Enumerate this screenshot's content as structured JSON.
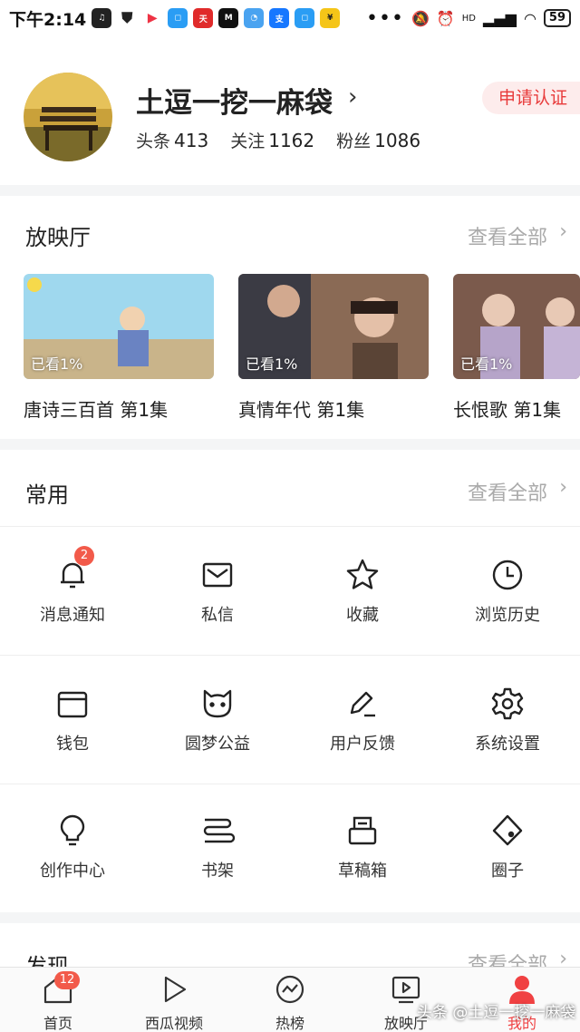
{
  "status_bar": {
    "time": "下午2:14",
    "battery": "59",
    "network": "HD"
  },
  "profile": {
    "username": "土逗一挖一麻袋",
    "stats": [
      {
        "label": "头条",
        "value": "413"
      },
      {
        "label": "关注",
        "value": "1162"
      },
      {
        "label": "粉丝",
        "value": "1086"
      }
    ],
    "verify_button": "申请认证"
  },
  "cinema": {
    "title": "放映厅",
    "more": "查看全部",
    "cards": [
      {
        "title": "唐诗三百首 第1集",
        "progress": "已看1%"
      },
      {
        "title": "真情年代 第1集",
        "progress": "已看1%"
      },
      {
        "title": "长恨歌 第1集",
        "progress": "已看1%"
      }
    ]
  },
  "common": {
    "title": "常用",
    "more": "查看全部",
    "items": [
      {
        "label": "消息通知",
        "icon": "bell-icon",
        "badge": "2"
      },
      {
        "label": "私信",
        "icon": "mail-icon"
      },
      {
        "label": "收藏",
        "icon": "star-icon"
      },
      {
        "label": "浏览历史",
        "icon": "clock-icon"
      },
      {
        "label": "钱包",
        "icon": "wallet-icon"
      },
      {
        "label": "圆梦公益",
        "icon": "charity-icon"
      },
      {
        "label": "用户反馈",
        "icon": "feedback-pen-icon"
      },
      {
        "label": "系统设置",
        "icon": "gear-icon"
      },
      {
        "label": "创作中心",
        "icon": "lightbulb-icon"
      },
      {
        "label": "书架",
        "icon": "bookshelf-icon"
      },
      {
        "label": "草稿箱",
        "icon": "draft-box-icon"
      },
      {
        "label": "圈子",
        "icon": "circle-icon"
      }
    ]
  },
  "discover": {
    "title": "发现",
    "more": "查看全部"
  },
  "tabbar": {
    "tabs": [
      {
        "label": "首页",
        "icon": "home-icon",
        "badge": "12"
      },
      {
        "label": "西瓜视频",
        "icon": "play-icon"
      },
      {
        "label": "热榜",
        "icon": "trending-icon"
      },
      {
        "label": "放映厅",
        "icon": "cinema-icon"
      },
      {
        "label": "我的",
        "icon": "person-icon"
      }
    ]
  },
  "watermark": "头条 @土逗一挖一麻袋",
  "colors": {
    "accent": "#f04142",
    "badge": "#f25a4a"
  }
}
